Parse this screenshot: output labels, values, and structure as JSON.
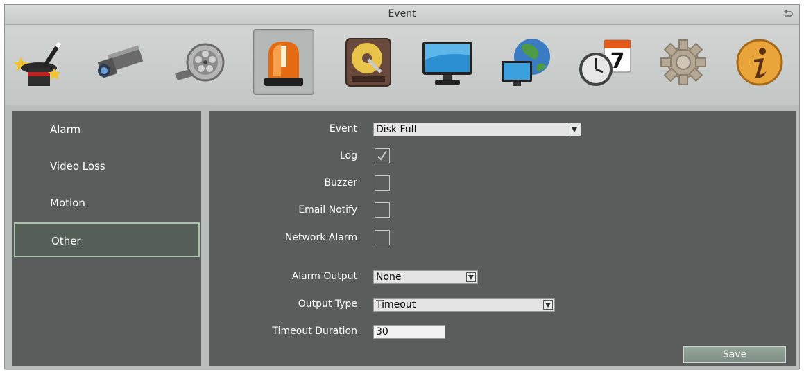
{
  "window": {
    "title": "Event"
  },
  "toolbar": {
    "icons": [
      "wizard-icon",
      "camera-icon",
      "film-reel-icon",
      "alarm-light-icon",
      "hard-drive-icon",
      "monitor-icon",
      "network-globe-icon",
      "schedule-clock-calendar-icon",
      "gear-icon",
      "info-icon"
    ],
    "calendar_day": "7",
    "active_index": 3
  },
  "sidebar": {
    "items": [
      {
        "label": "Alarm"
      },
      {
        "label": "Video Loss"
      },
      {
        "label": "Motion"
      },
      {
        "label": "Other"
      }
    ],
    "selected": "Other"
  },
  "form": {
    "event_label": "Event",
    "event_value": "Disk Full",
    "log_label": "Log",
    "log_checked": true,
    "buzzer_label": "Buzzer",
    "buzzer_checked": false,
    "email_label": "Email Notify",
    "email_checked": false,
    "network_label": "Network Alarm",
    "network_checked": false,
    "alarm_output_label": "Alarm Output",
    "alarm_output_value": "None",
    "output_type_label": "Output Type",
    "output_type_value": "Timeout",
    "timeout_label": "Timeout Duration",
    "timeout_value": "30",
    "save_label": "Save"
  },
  "colors": {
    "panel": "#5b5c5c",
    "frame": "#c9cdcb",
    "selected_border": "#a9c3ae",
    "save_button": "#8a9a90"
  }
}
